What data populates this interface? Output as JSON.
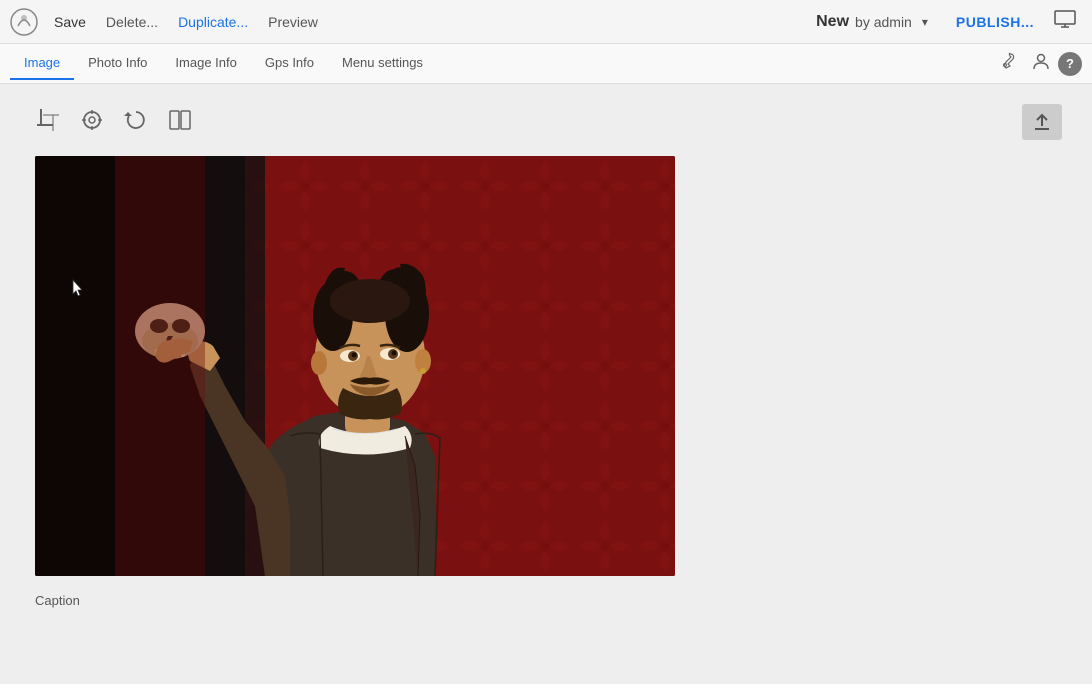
{
  "toolbar": {
    "save_label": "Save",
    "delete_label": "Delete...",
    "duplicate_label": "Duplicate...",
    "preview_label": "Preview",
    "status_new": "New",
    "status_by": "by admin",
    "publish_label": "PUBLISH...",
    "dropdown_arrow": "▾"
  },
  "tabs": {
    "image_label": "Image",
    "photo_info_label": "Photo Info",
    "image_info_label": "Image Info",
    "gps_info_label": "Gps Info",
    "menu_settings_label": "Menu settings",
    "active_tab": "image"
  },
  "image_tools": {
    "crop_icon": "✂",
    "focus_icon": "◎",
    "rotate_icon": "↺",
    "columns_icon": "⊞",
    "upload_icon": "⬆"
  },
  "caption": {
    "label": "Caption"
  },
  "help": {
    "label": "?"
  }
}
